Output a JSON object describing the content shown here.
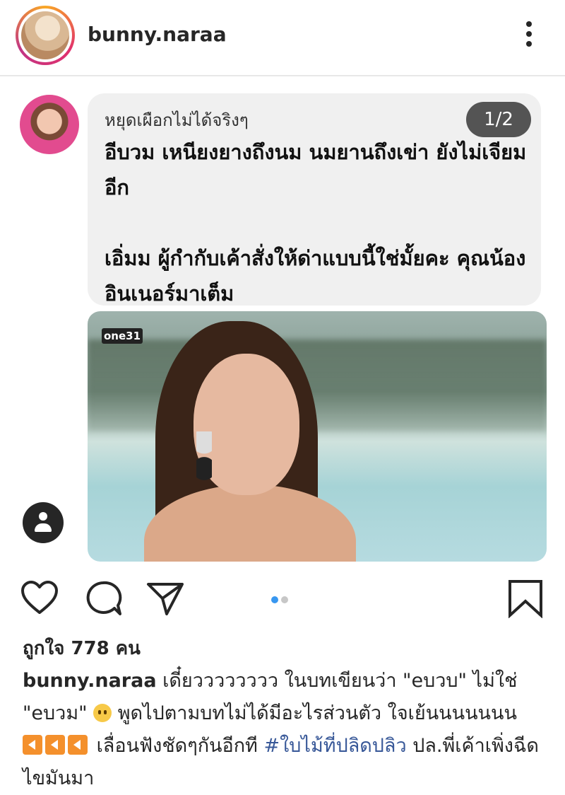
{
  "header": {
    "username": "bunny.naraa"
  },
  "post": {
    "comment": {
      "name": "หยุดเผือกไม่ได้จริงๆ",
      "text": "อีบวม เหนียงยางถึงนม นมยานถึงเข่า ยังไม่เจียมอีก\n\nเอิ่มม ผู้กำกับเค้าสั่งให้ด่าแบบนี้ใช่มั้ยคะ คุณน้อง อินเนอร์มาเต็ม"
    },
    "image_counter": "1/2",
    "channel_logo": "one31"
  },
  "carousel": {
    "total": 2,
    "active": 1,
    "active_color": "#3897f0",
    "inactive_color": "#c7c7c7"
  },
  "likes_text": "ถูกใจ 778 คน",
  "caption": {
    "username": "bunny.naraa",
    "part1": " เดี๋ยวววววววว ในบทเขียนว่า \"eบวบ\" ไม่ใช่ \"eบวม\" ",
    "emoji1": "neutral-face",
    "part2": " พูดไปตามบทไม่ได้มีอะไรส่วนตัว ใจเย้นนนนนนน ",
    "emoji2": "reverse-arrow-x3",
    "part3": " เลื่อนฟังชัดๆกันอีกที ",
    "hashtag": "#ใบไม้ที่ปลิดปลิว",
    "part4": " ปล.พี่เค้าเพิ่งฉีดไขมันมา"
  },
  "icons": {
    "more": "more-vertical-icon",
    "like": "heart-icon",
    "comment": "comment-icon",
    "share": "send-icon",
    "save": "bookmark-icon",
    "tag": "user-tag-icon"
  }
}
